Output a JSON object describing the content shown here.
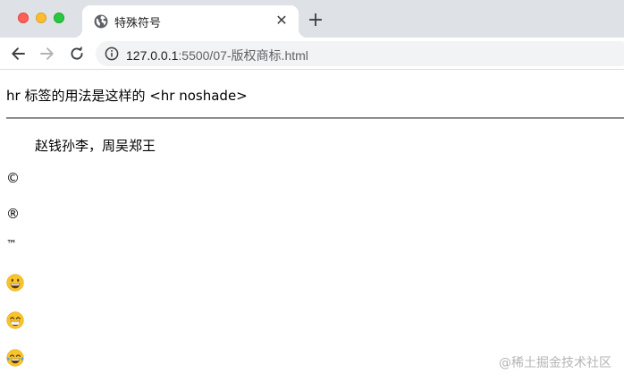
{
  "browser": {
    "tab": {
      "title": "特殊符号",
      "favicon": "globe-icon",
      "close_glyph": "✕"
    },
    "new_tab_glyph": "+",
    "address": {
      "host": "127.0.0.1",
      "path": ":5500/07-版权商标.html"
    }
  },
  "page": {
    "intro_text": "hr 标签的用法是这样的 <hr noshade>",
    "indented_text": "赵钱孙李，周吴郑王",
    "symbols": {
      "copyright": "©",
      "registered": "®",
      "trademark": "™"
    },
    "emojis": [
      "grinning-face-icon",
      "beaming-face-icon",
      "tears-of-joy-icon"
    ],
    "watermark": "@稀土掘金技术社区"
  },
  "colors": {
    "tabstrip_bg": "#dee1e6",
    "omnibox_bg": "#f1f3f4",
    "traffic_close": "#fe5f57",
    "traffic_min": "#febc2e",
    "traffic_max": "#28c840",
    "emoji_yellow": "#f8c42c"
  }
}
